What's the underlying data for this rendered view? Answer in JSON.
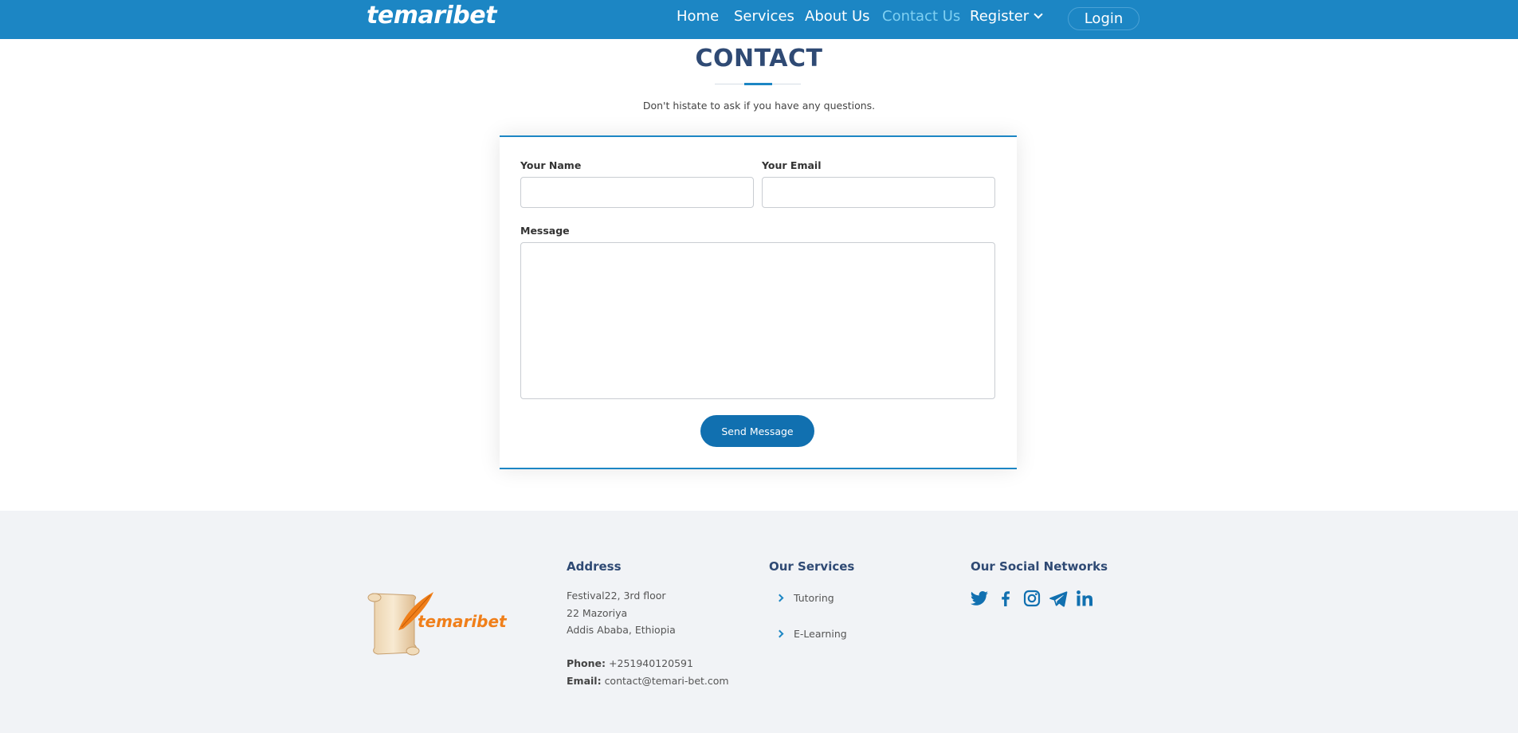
{
  "header": {
    "brand": "temaribet",
    "nav": [
      {
        "label": "Home",
        "active": false
      },
      {
        "label": "Services",
        "active": false
      },
      {
        "label": "About Us",
        "active": false
      },
      {
        "label": "Contact Us",
        "active": true
      },
      {
        "label": "Register",
        "active": false,
        "dropdown": true
      }
    ],
    "login_label": "Login"
  },
  "contact": {
    "title": "CONTACT",
    "subtitle": "Don't histate to ask if you have any questions.",
    "form": {
      "name_label": "Your Name",
      "name_value": "",
      "email_label": "Your Email",
      "email_value": "",
      "message_label": "Message",
      "message_value": "",
      "submit_label": "Send Message"
    }
  },
  "footer": {
    "logo_text": "temaribet",
    "address": {
      "heading": "Address",
      "lines": [
        "Festival22, 3rd floor",
        "22 Mazoriya",
        "Addis Ababa, Ethiopia"
      ],
      "phone_label": "Phone:",
      "phone": "+251940120591",
      "email_label": "Email:",
      "email": "contact@temari-bet.com"
    },
    "services": {
      "heading": "Our Services",
      "items": [
        "Tutoring",
        "E-Learning"
      ]
    },
    "social": {
      "heading": "Our Social Networks",
      "icons": [
        "twitter-icon",
        "facebook-icon",
        "instagram-icon",
        "telegram-icon",
        "linkedin-icon"
      ]
    }
  },
  "colors": {
    "header_bg": "#1c86c4",
    "accent": "#1170b0",
    "active_nav": "#7fd0f2",
    "title": "#2f4a74",
    "footer_bg": "#f1f3f6",
    "logo_orange": "#f07f1a"
  }
}
